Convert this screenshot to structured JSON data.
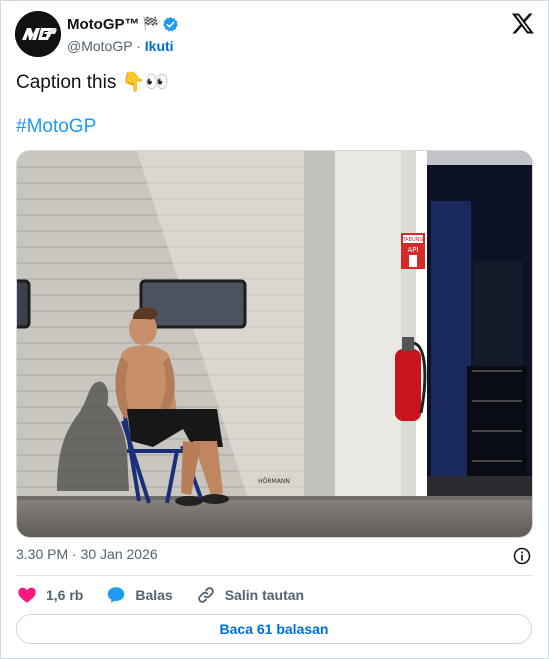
{
  "author": {
    "name": "MotoGP™",
    "badge_glyph": "🏁",
    "handle": "@MotoGP",
    "separator": "·",
    "follow_label": "Ikuti",
    "avatar_text": "MGP"
  },
  "tweet": {
    "text": "Caption this",
    "emojis": "👇👀",
    "hashtag": "#MotoGP"
  },
  "media": {
    "garage_sign_top": "TABUNG",
    "garage_sign_bottom": "API",
    "door_brand": "HÖRMANN"
  },
  "meta": {
    "timestamp": "3.30 PM · 30 Jan 2026"
  },
  "actions": {
    "likes_count": "1,6 rb",
    "reply_label": "Balas",
    "copy_link_label": "Salin tautan"
  },
  "replies_button": {
    "label": "Baca 61 balasan"
  },
  "colors": {
    "accent": "#1d9bf0",
    "follow": "#006fd6",
    "heart": "#f91880",
    "muted": "#536471"
  }
}
